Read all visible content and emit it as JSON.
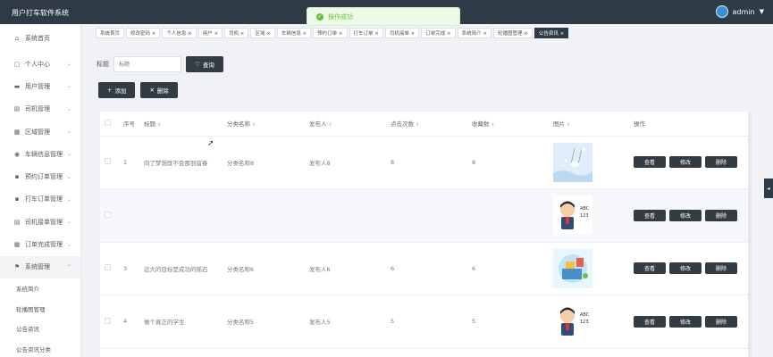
{
  "app": {
    "title": "用户打车软件系统"
  },
  "user": {
    "name": "admin",
    "caret": "▼"
  },
  "toast": {
    "message": "操作成功",
    "icon": "✓"
  },
  "sidebar": {
    "items": [
      {
        "label": "系统首页",
        "icon": "⌂"
      },
      {
        "label": "个人中心",
        "icon": "▢"
      },
      {
        "label": "用户管理",
        "icon": "▬"
      },
      {
        "label": "司机管理",
        "icon": "▤"
      },
      {
        "label": "区域管理",
        "icon": "▦"
      },
      {
        "label": "车辆信息管理",
        "icon": "◉"
      },
      {
        "label": "预约订单管理",
        "icon": "▪"
      },
      {
        "label": "打车订单管理",
        "icon": "▪"
      },
      {
        "label": "司机接单管理",
        "icon": "▤"
      },
      {
        "label": "订单完成管理",
        "icon": "▦"
      },
      {
        "label": "系统管理",
        "icon": "⚑"
      }
    ],
    "sub_items": [
      "系统简介",
      "轮播图管理",
      "公告资讯",
      "公告资讯分类"
    ],
    "chevron": "⌄",
    "chevron_open": "⌃"
  },
  "tabs": [
    "系统首页",
    "修改密码 ×",
    "个人信息 ×",
    "用户 ×",
    "司机 ×",
    "区域 ×",
    "车辆信息 ×",
    "预约订单 ×",
    "打车订单 ×",
    "司机接单 ×",
    "订单完成 ×",
    "系统简介 ×",
    "轮播图管理 ×",
    "公告资讯 ×"
  ],
  "search": {
    "label": "标题",
    "placeholder": "标题",
    "button": "查询",
    "button_icon": "♡"
  },
  "actions": {
    "add": "添加",
    "add_icon": "+",
    "delete": "删除",
    "delete_icon": "✕"
  },
  "table": {
    "headers": [
      "序号",
      "标题",
      "分类名称",
      "发布人",
      "点击次数",
      "收藏数",
      "图片",
      "操作"
    ],
    "sort_icon": "⇕",
    "rows": [
      {
        "index": "1",
        "title": "向了梦想既不会那到留春",
        "category": "分类名称8",
        "publisher": "发布人8",
        "clicks": "8",
        "favorites": "8",
        "image": "bird-swing"
      },
      {
        "index": "",
        "title": "",
        "category": "",
        "publisher": "",
        "clicks": "",
        "favorites": "",
        "image": "cartoon-boy"
      },
      {
        "index": "3",
        "title": "远大的目标是成功的摇石",
        "category": "分类名称6",
        "publisher": "发布人6",
        "clicks": "6",
        "favorites": "6",
        "image": "study-desk"
      },
      {
        "index": "4",
        "title": "做个真正的学生",
        "category": "分类名称5",
        "publisher": "发布人5",
        "clicks": "5",
        "favorites": "5",
        "image": "cartoon-boy"
      }
    ],
    "row_buttons": {
      "view": "查看",
      "edit": "修改",
      "delete": "删除"
    }
  },
  "side_handle": "◂"
}
